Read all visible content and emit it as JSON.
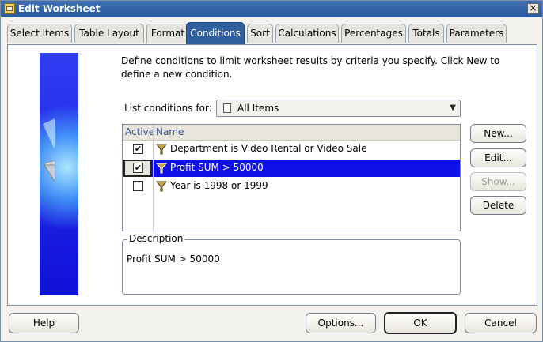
{
  "window": {
    "title": "Edit Worksheet",
    "close_label": "×"
  },
  "tabs": [
    {
      "label": "Select Items",
      "active": false
    },
    {
      "label": "Table Layout",
      "active": false
    },
    {
      "label": "Format",
      "active": false
    },
    {
      "label": "Conditions",
      "active": true
    },
    {
      "label": "Sort",
      "active": false
    },
    {
      "label": "Calculations",
      "active": false
    },
    {
      "label": "Percentages",
      "active": false
    },
    {
      "label": "Totals",
      "active": false
    },
    {
      "label": "Parameters",
      "active": false
    }
  ],
  "intro": "Define conditions to limit worksheet results by criteria you specify. Click New to define a new condition.",
  "list_for": {
    "label": "List conditions for:",
    "value": "All Items"
  },
  "table": {
    "headers": [
      "Active",
      "Name"
    ],
    "rows": [
      {
        "active": true,
        "name": "Department is Video Rental or Video Sale",
        "selected": false
      },
      {
        "active": true,
        "name": "Profit SUM > 50000",
        "selected": true
      },
      {
        "active": false,
        "name": "Year is 1998 or 1999",
        "selected": false
      }
    ]
  },
  "side_buttons": {
    "new": "New...",
    "edit": "Edit...",
    "show": "Show...",
    "delete": "Delete"
  },
  "description": {
    "legend": "Description",
    "text": "Profit SUM > 50000"
  },
  "footer": {
    "help": "Help",
    "options": "Options...",
    "ok": "OK",
    "cancel": "Cancel"
  },
  "colors": {
    "accent": "#2f5f9f",
    "selection": "#0f10e6",
    "art": "#1a22e6"
  }
}
